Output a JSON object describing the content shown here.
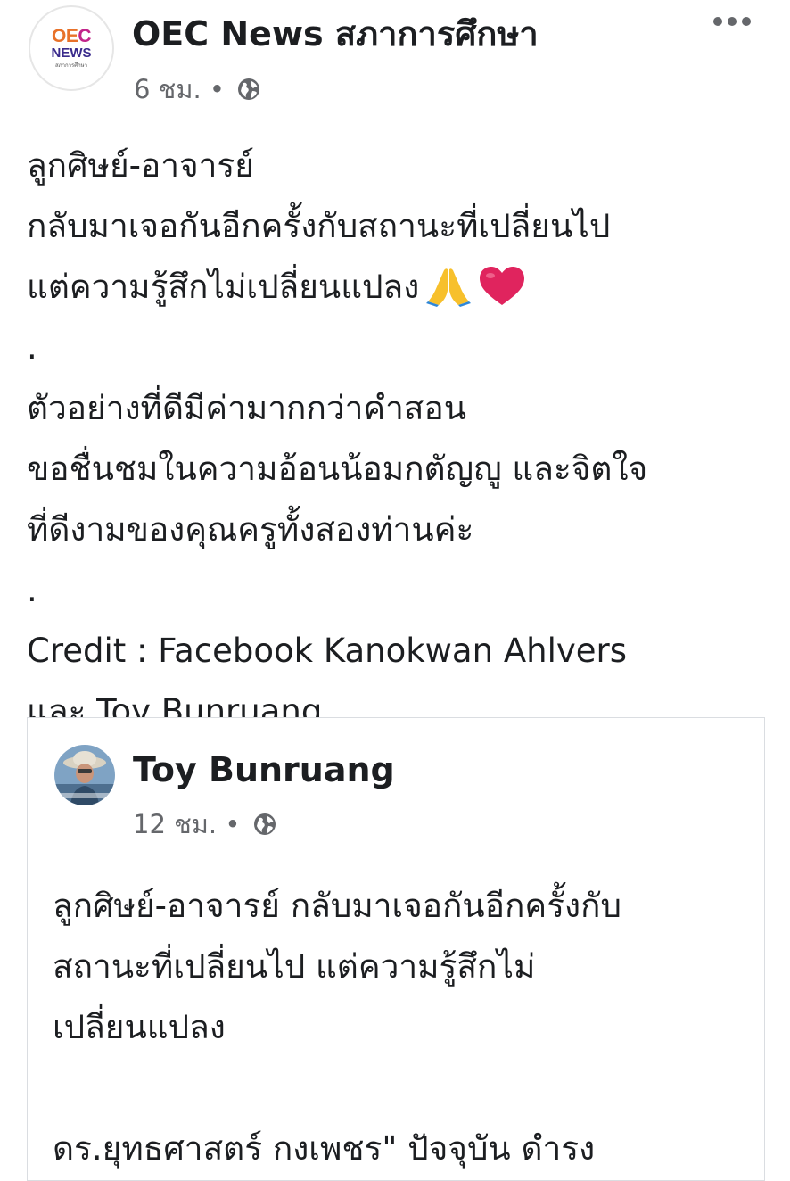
{
  "post": {
    "page_name": "OEC News สภาการศึกษา",
    "avatar_logo": {
      "line1_a": "OE",
      "line1_b": "C",
      "line2": "NEWS",
      "line3": "สภาการศึกษา"
    },
    "time": "6 ชม.",
    "separator": "•",
    "privacy_icon": "globe-icon",
    "more_icon": "more-dots-icon",
    "body_lines": [
      "ลูกศิษย์-อาจารย์",
      "กลับมาเจอกันอีกครั้งกับสถานะที่เปลี่ยนไป",
      "แต่ความรู้สึกไม่เปลี่ยนแปลง",
      ".",
      "ตัวอย่างที่ดีมีค่ามากกว่าคำสอน",
      "ขอชื่นชมในความอ้อนน้อมกตัญญู และจิตใจ",
      "ที่ดีงามของคุณครูทั้งสองท่านค่ะ",
      ".",
      "Credit : Facebook Kanokwan Ahlvers",
      "และ Toy Bunruang"
    ],
    "emojis": [
      "folded-hands-emoji",
      "red-heart-emoji"
    ]
  },
  "shared_post": {
    "author": "Toy Bunruang",
    "time": "12 ชม.",
    "separator": "•",
    "privacy_icon": "globe-icon",
    "body_lines": [
      "ลูกศิษย์-อาจารย์ กลับมาเจอกันอีกครั้งกับ",
      "สถานะที่เปลี่ยนไป แต่ความรู้สึกไม่",
      "เปลี่ยนแปลง",
      "",
      "ดร.ยุทธศาสตร์ กงเพชร\" ปัจจุบัน ดำรง"
    ]
  },
  "colors": {
    "text": "#1c1e21",
    "secondary_text": "#65676b",
    "card_border": "#dadde1",
    "heart": "#e0245e"
  }
}
